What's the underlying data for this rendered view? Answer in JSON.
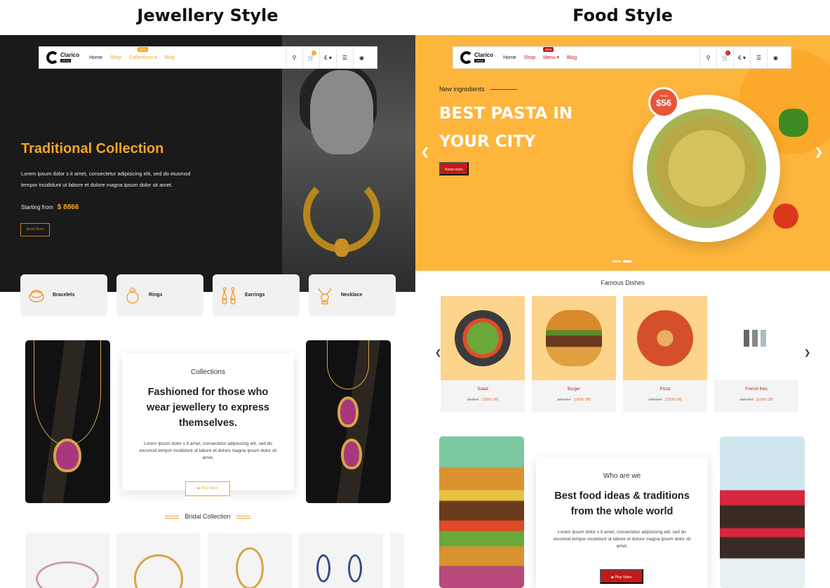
{
  "left": {
    "section_title": "Jewellery Style",
    "header": {
      "logo": "Clarico",
      "logo_sub": "VEGA",
      "nav": [
        "Home",
        "Shop",
        "Collections",
        "Blog"
      ],
      "nav_badge": "NEW",
      "cart_count": "0",
      "currency": "€",
      "accent": "#f5a623"
    },
    "hero": {
      "title": "Traditional Collection",
      "description": "Lorem ipsum dolor s it amet, consectetur adipisicing elit, sed do eiusmod tempor incididunt ut labore et dolore magna ipsum dolor sit amet.",
      "starting_label": "Starting from",
      "price": "$ 8866",
      "button": "Read More"
    },
    "categories": [
      {
        "label": "Bracelets",
        "icon": "bracelet-icon"
      },
      {
        "label": "Rings",
        "icon": "ring-icon"
      },
      {
        "label": "Earrings",
        "icon": "earrings-icon"
      },
      {
        "label": "Necklace",
        "icon": "necklace-icon"
      }
    ],
    "collections": {
      "subtitle": "Collections",
      "heading": "Fashioned for those who wear jewellery to express themselves.",
      "text": "Lorem ipsum dolor s it amet, consectetur adipisicing elit, sed do eiusmod tempor incididunt ut labore et dolore magna ipsum dolor sit amet,",
      "button": "Play Video"
    },
    "bridal_title": "Bridal Collection"
  },
  "right": {
    "section_title": "Food Style",
    "header": {
      "logo": "Clarico",
      "logo_sub": "VEGA",
      "nav": [
        "Home",
        "Shop",
        "Menu",
        "Blog"
      ],
      "nav_badge": "NEW",
      "cart_count": "0",
      "currency": "€",
      "accent": "#c21a1a"
    },
    "hero": {
      "tagline": "New ingredients",
      "title": "BEST PASTA IN YOUR CITY",
      "button": "Know more",
      "badge_from": "FROM",
      "badge_price": "$56",
      "prev_icon": "chevron-left-icon",
      "next_icon": "chevron-right-icon"
    },
    "famous_title": "Famous Dishes",
    "dishes": [
      {
        "name": "Salad",
        "old_price": "20.00 €",
        "off": "(100% Off)"
      },
      {
        "name": "Burger",
        "old_price": "100.00 €",
        "off": "(100% Off)"
      },
      {
        "name": "Pizza",
        "old_price": "120.00 €",
        "off": "(100% Off)"
      },
      {
        "name": "French fries",
        "old_price": "133.00 €",
        "off": "(100% Off)"
      }
    ],
    "who": {
      "subtitle": "Who are we",
      "heading": "Best food ideas & traditions from the whole world",
      "text": "Lorem ipsum dolor s it amet, consectetur adipisicing elit, sed do eiusmod tempor incididunt ut labore et dolore magna ipsum dolor sit amet,",
      "button": "Play Video"
    }
  }
}
